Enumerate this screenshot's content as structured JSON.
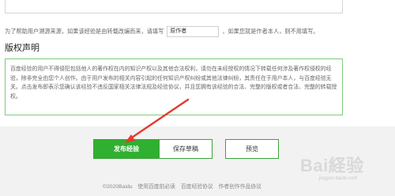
{
  "source_note": {
    "prefix": "为了帮助用户溯源来源，如果该经验是由转载改编而来，请填写",
    "author_value": "原作者",
    "suffix": "，如果您就是作者本人，则不用填写。"
  },
  "copyright": {
    "title": "版权声明",
    "text": "百度经验的用户不得侵犯包括他人的著作权在内的知识产权以及其他合法权利，请勿在未经授权的情况下转载任何涉及著作权侵权的经验，除非完全由您个人创作。由于用户发布的相关内容引起的任何知识产权纠纷或其他法律纠纷，其责任在于用户本人，与百度经验无关。点击发布即表示您确认该经验不违反国家相关法律法规及经验协议，并且您拥有该经验的合法、完整的版权或者合法、完整的转载授权。"
  },
  "actions": {
    "publish_label": "发布经验",
    "save_draft_label": "保存草稿",
    "preview_label": "预览"
  },
  "footer": {
    "copyright": "©2020Baidu",
    "links": [
      "使用百度前必读",
      "百度经验协议",
      "作者创作作品协议"
    ]
  },
  "watermark": {
    "text": "Bai経验",
    "sub": "jingyan.baidu.com"
  },
  "colors": {
    "brand_green": "#30b030",
    "border_green": "#7fca7f",
    "annotation_red": "#e53a2e"
  }
}
